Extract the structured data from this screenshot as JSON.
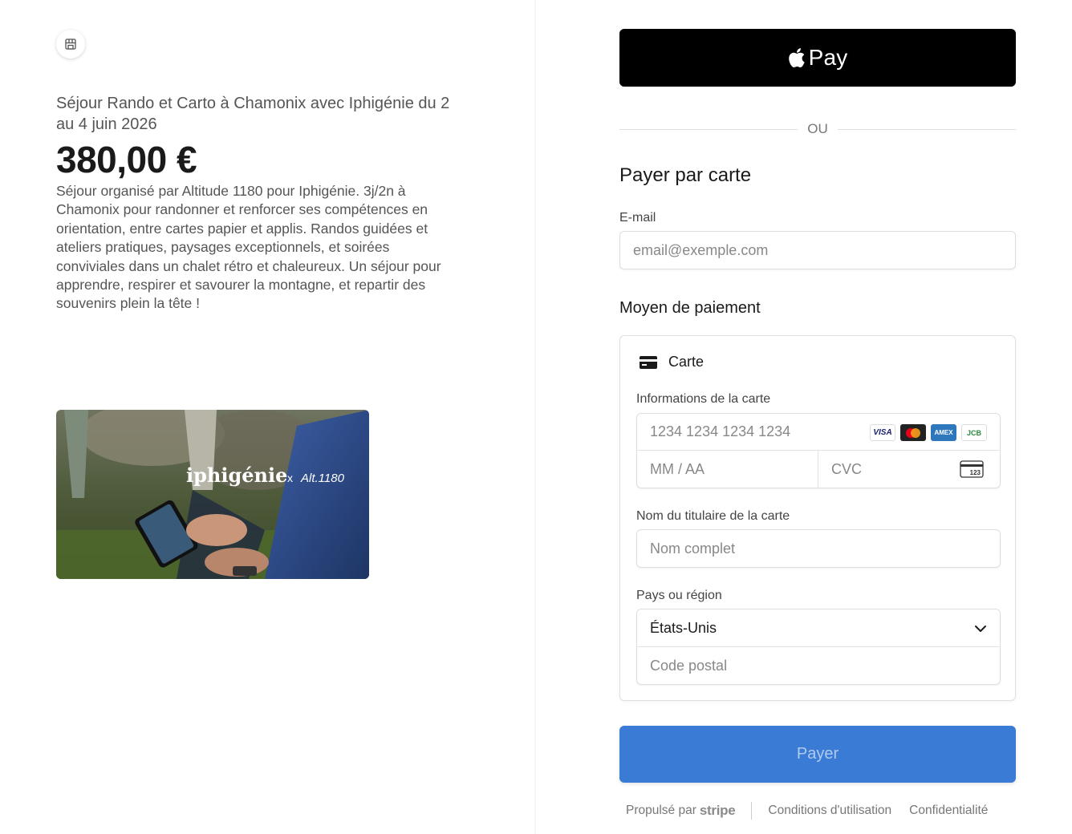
{
  "left": {
    "product_name": "Séjour Rando et Carto à Chamonix avec Iphigénie du 2 au 4 juin 2026",
    "price": "380,00 €",
    "description": "Séjour organisé par Altitude 1180 pour Iphigénie. 3j/2n à Chamonix pour randonner et renforcer ses compétences en orientation, entre cartes papier et applis. Randos guidées et ateliers pratiques, paysages exceptionnels, et soirées conviviales dans un chalet rétro et chaleureux. Un séjour pour apprendre, respirer et savourer la montagne, et repartir des souvenirs plein la tête !",
    "image_logo": "iphigénie",
    "image_x": "x",
    "image_partner": "Alt.1180"
  },
  "right": {
    "apple_pay_label": "Pay",
    "or_label": "OU",
    "pay_by_card_title": "Payer par carte",
    "email_label": "E-mail",
    "email_placeholder": "email@exemple.com",
    "payment_method_title": "Moyen de paiement",
    "card_tab_label": "Carte",
    "card_info_label": "Informations de la carte",
    "card_number_placeholder": "1234 1234 1234 1234",
    "expiry_placeholder": "MM / AA",
    "cvc_placeholder": "CVC",
    "cvc_icon_text": "123",
    "brands": [
      "VISA",
      "AMEX",
      "JCB"
    ],
    "holder_label": "Nom du titulaire de la carte",
    "holder_placeholder": "Nom complet",
    "country_label": "Pays ou région",
    "country_value": "États-Unis",
    "postal_placeholder": "Code postal",
    "pay_button": "Payer",
    "footer": {
      "powered_by": "Propulsé par",
      "stripe": "stripe",
      "terms": "Conditions d'utilisation",
      "privacy": "Confidentialité"
    }
  },
  "colors": {
    "pay_button": "#3a7bd5",
    "apple_pay_bg": "#000000"
  }
}
